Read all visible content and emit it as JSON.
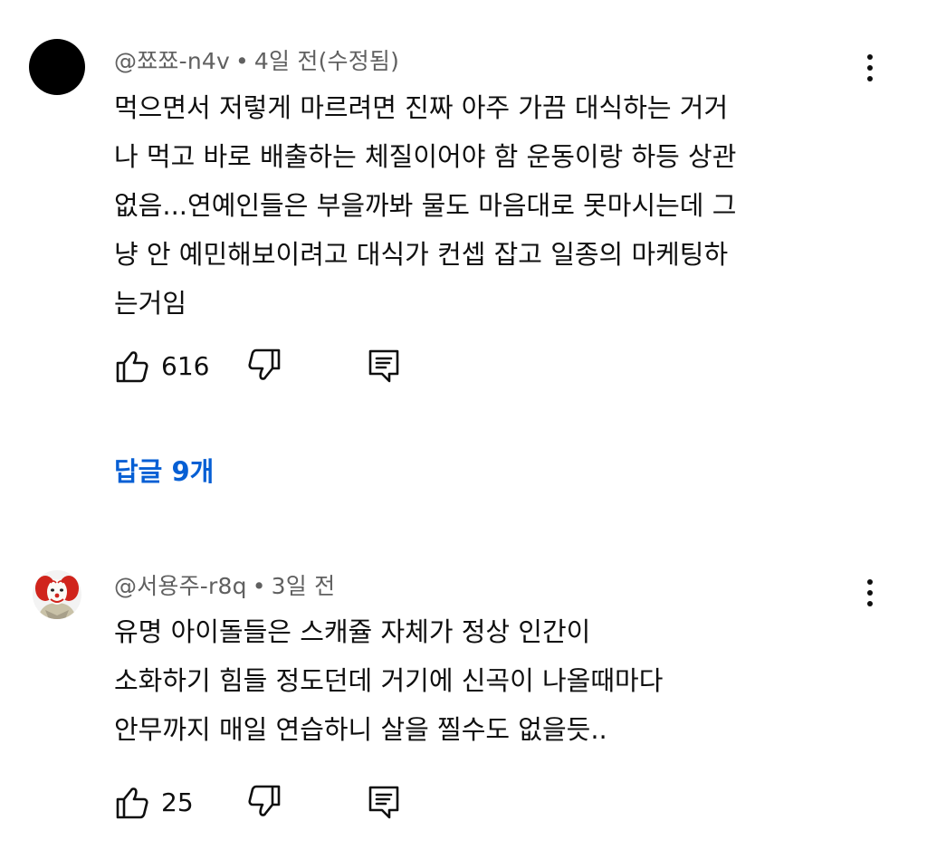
{
  "comments": [
    {
      "author": "@쬬쬬-n4v",
      "separator": "•",
      "time": "4일 전(수정됨)",
      "lines": [
        "먹으면서 저렇게 마르려면 진짜 아주 가끔 대식하는 거거",
        "나 먹고 바로 배출하는 체질이어야 함 운동이랑 하등 상관",
        "없음...연예인들은 부을까봐 물도 마음대로 못마시는데 그",
        "냥 안 예민해보이려고 대식가 컨셉 잡고 일종의 마케팅하",
        "는거임"
      ],
      "likes": "616",
      "replies_label": "답글 9개",
      "avatar_color": "#000000"
    },
    {
      "author": "@서용주-r8q",
      "separator": "•",
      "time": "3일 전",
      "lines": [
        "유명 아이돌들은 스캐쥴 자체가 정상 인간이",
        "소화하기 힘들 정도던데 거기에 신곡이 나올때마다",
        "안무까지 매일 연습하니 살을 찔수도 없을듯.."
      ],
      "likes": "25"
    }
  ],
  "icons": {
    "like": "thumbs-up-icon",
    "dislike": "thumbs-down-icon",
    "reply": "reply-icon",
    "menu": "more-vert-icon"
  },
  "colors": {
    "text": "#0f0f0f",
    "meta": "#606060",
    "link": "#065fd4"
  }
}
